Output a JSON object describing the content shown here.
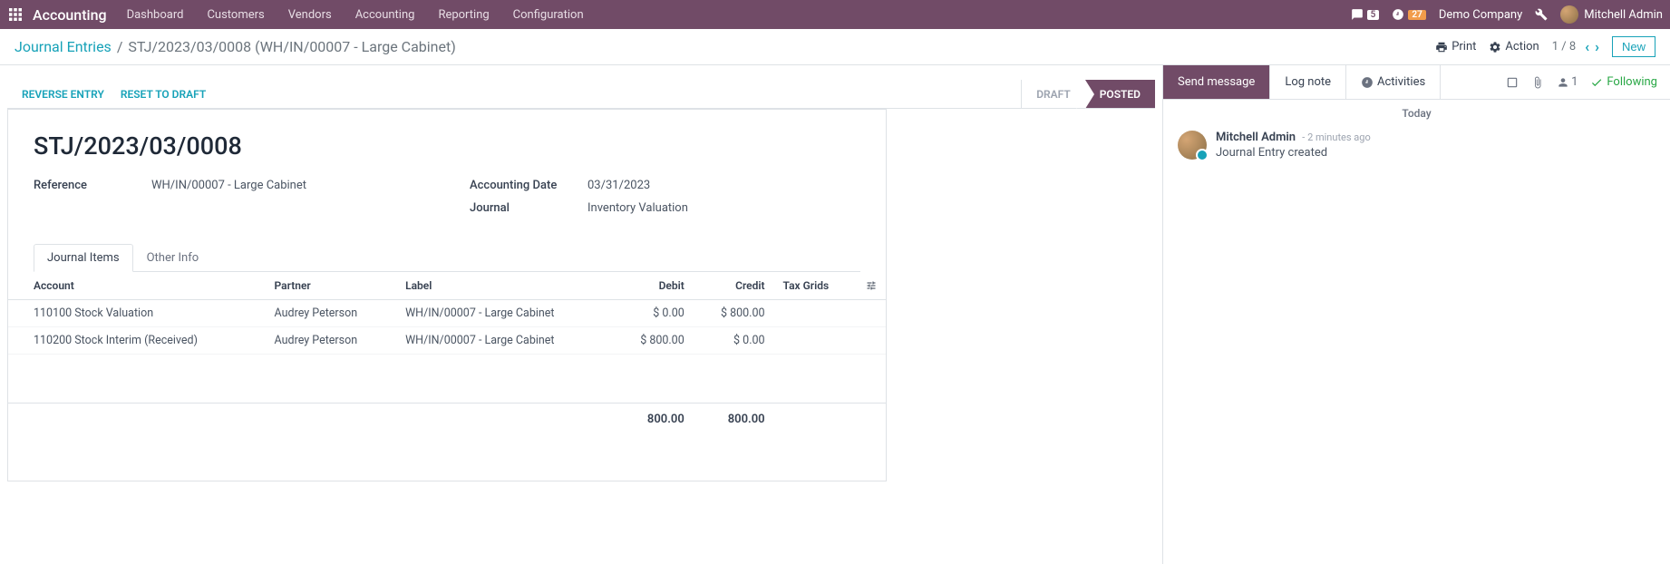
{
  "nav": {
    "brand": "Accounting",
    "menu": [
      "Dashboard",
      "Customers",
      "Vendors",
      "Accounting",
      "Reporting",
      "Configuration"
    ],
    "msg_count": "5",
    "clock_count": "27",
    "company": "Demo Company",
    "user": "Mitchell Admin"
  },
  "breadcrumb": {
    "parent": "Journal Entries",
    "current": "STJ/2023/03/0008 (WH/IN/00007 - Large Cabinet)"
  },
  "control": {
    "print": "Print",
    "action": "Action",
    "pager": "1 / 8",
    "new": "New"
  },
  "status": {
    "reverse": "REVERSE ENTRY",
    "reset": "RESET TO DRAFT",
    "draft": "DRAFT",
    "posted": "POSTED"
  },
  "record": {
    "title": "STJ/2023/03/0008",
    "fields": {
      "reference_label": "Reference",
      "reference": "WH/IN/00007 - Large Cabinet",
      "date_label": "Accounting Date",
      "date": "03/31/2023",
      "journal_label": "Journal",
      "journal": "Inventory Valuation"
    }
  },
  "tabs": {
    "items": "Journal Items",
    "other": "Other Info"
  },
  "table": {
    "headers": {
      "account": "Account",
      "partner": "Partner",
      "label": "Label",
      "debit": "Debit",
      "credit": "Credit",
      "tax": "Tax Grids"
    },
    "rows": [
      {
        "account": "110100 Stock Valuation",
        "partner": "Audrey Peterson",
        "label": "WH/IN/00007 - Large Cabinet",
        "debit": "$ 0.00",
        "credit": "$ 800.00"
      },
      {
        "account": "110200 Stock Interim (Received)",
        "partner": "Audrey Peterson",
        "label": "WH/IN/00007 - Large Cabinet",
        "debit": "$ 800.00",
        "credit": "$ 0.00"
      }
    ],
    "totals": {
      "debit": "800.00",
      "credit": "800.00"
    }
  },
  "chatter": {
    "send": "Send message",
    "log": "Log note",
    "activities": "Activities",
    "follow": "Following",
    "follower_count": "1",
    "today": "Today",
    "msg": {
      "author": "Mitchell Admin",
      "time": "2 minutes ago",
      "body": "Journal Entry created"
    }
  }
}
